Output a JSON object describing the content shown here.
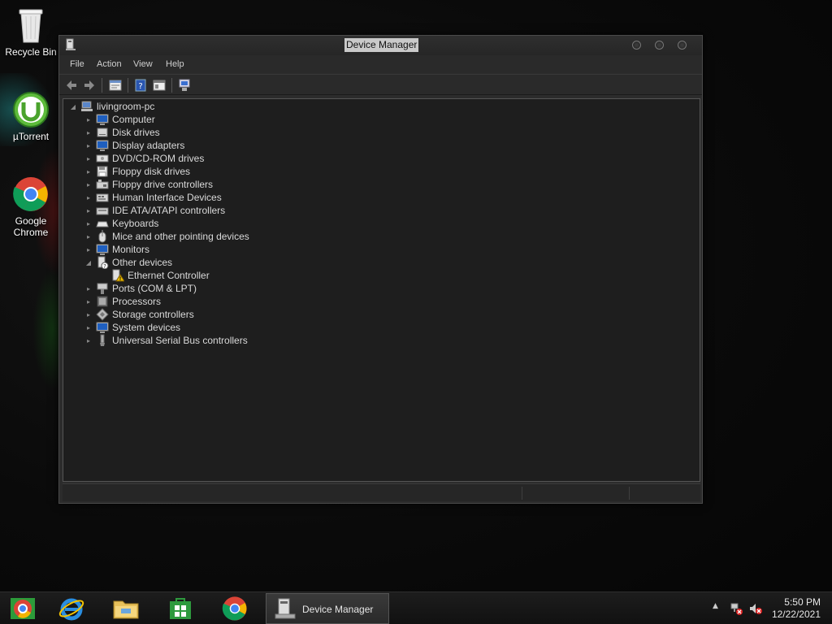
{
  "desktop": {
    "icons": [
      {
        "label": "Recycle Bin"
      },
      {
        "label": "µTorrent"
      },
      {
        "label": "Google Chrome"
      }
    ]
  },
  "window": {
    "title": "Device Manager",
    "menu": [
      "File",
      "Action",
      "View",
      "Help"
    ],
    "toolbar_icons": [
      "back-arrow-icon",
      "forward-arrow-icon",
      "properties-icon",
      "help-icon",
      "console-view-icon",
      "scan-hardware-icon"
    ]
  },
  "tree": {
    "root": "livingroom-pc",
    "categories": [
      "Computer",
      "Disk drives",
      "Display adapters",
      "DVD/CD-ROM drives",
      "Floppy disk drives",
      "Floppy drive controllers",
      "Human Interface Devices",
      "IDE ATA/ATAPI controllers",
      "Keyboards",
      "Mice and other pointing devices",
      "Monitors",
      "Other devices",
      "Ports (COM & LPT)",
      "Processors",
      "Storage controllers",
      "System devices",
      "Universal Serial Bus controllers"
    ],
    "other_devices_children": [
      "Ethernet Controller"
    ],
    "expanded": [
      "Other devices"
    ]
  },
  "taskbar": {
    "pinned": [
      "file-explorer-chrome-icon",
      "internet-explorer-icon",
      "file-explorer-icon",
      "store-icon",
      "chrome-icon"
    ],
    "active_task": "Device Manager",
    "clock": {
      "time": "5:50 PM",
      "date": "12/22/2021"
    }
  },
  "colors": {
    "warning": "#f0c000",
    "accent_blue": "#1f5fbf"
  }
}
